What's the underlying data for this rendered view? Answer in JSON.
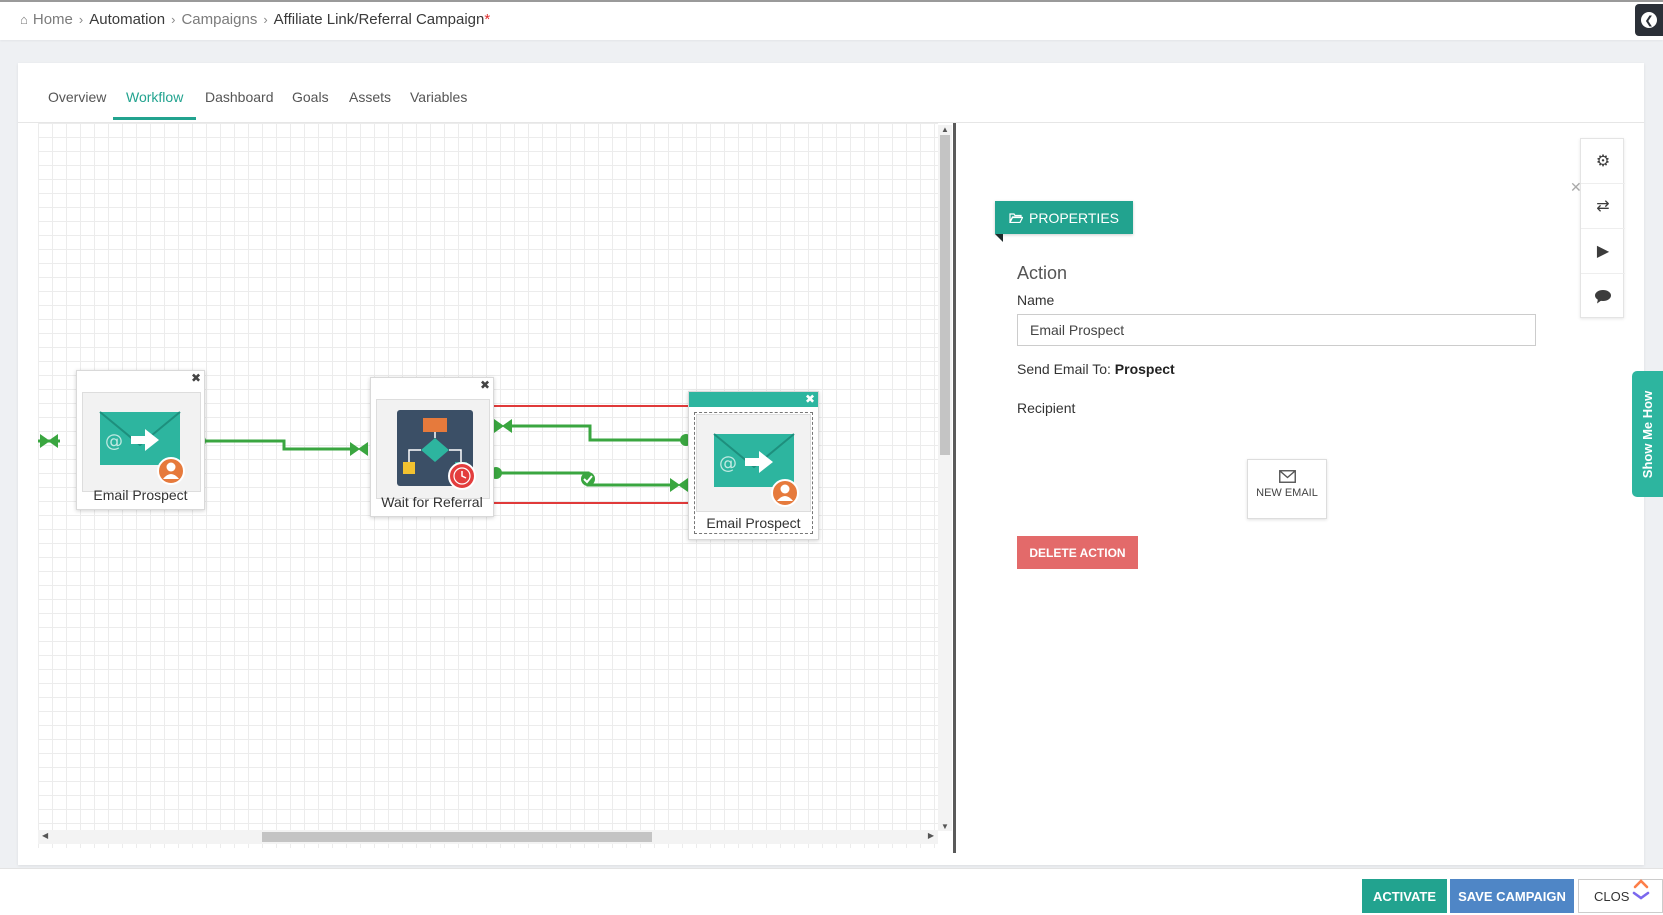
{
  "breadcrumb": {
    "home": "Home",
    "automation": "Automation",
    "campaigns": "Campaigns",
    "current": "Affiliate Link/Referral Campaign",
    "unsaved_marker": "*"
  },
  "tabs": [
    "Overview",
    "Workflow",
    "Dashboard",
    "Goals",
    "Assets",
    "Variables"
  ],
  "active_tab": "Workflow",
  "nodes": [
    {
      "label": "Email Prospect",
      "icon": "email-prospect-icon"
    },
    {
      "label": "Wait for Referral",
      "icon": "wait-flowchart-clock-icon"
    },
    {
      "label": "Email Prospect",
      "icon": "email-prospect-icon",
      "selected": true
    }
  ],
  "panel": {
    "properties_label": "PROPERTIES",
    "section_title": "Action",
    "name_label": "Name",
    "name_value": "Email Prospect",
    "send_to_label": "Send Email To:",
    "send_to_value": "Prospect",
    "recipient_label": "Recipient",
    "new_email_label": "NEW EMAIL",
    "delete_label": "DELETE ACTION"
  },
  "side_tools": [
    "gear-icon",
    "shuffle-icon",
    "play-icon",
    "comment-icon"
  ],
  "show_me_how": "Show Me How",
  "footer": {
    "activate": "ACTIVATE",
    "save": "SAVE CAMPAIGN",
    "close": "CLOS"
  },
  "colors": {
    "accent": "#22a38f",
    "connector": "#3aa640",
    "danger": "#e36a6a",
    "save": "#4f86c6",
    "highlight": "#e03a3a"
  }
}
